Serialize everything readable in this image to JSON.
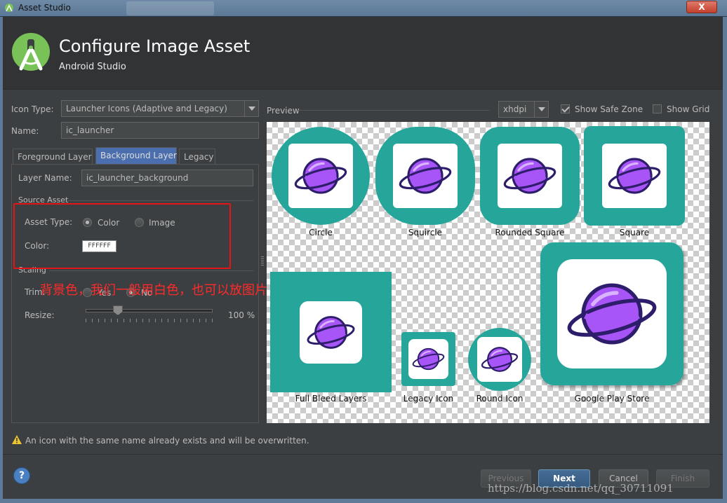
{
  "window": {
    "title": "Asset Studio",
    "close_label": "X"
  },
  "header": {
    "title": "Configure Image Asset",
    "subtitle": "Android Studio"
  },
  "form": {
    "icon_type_label": "Icon Type:",
    "icon_type_value": "Launcher Icons (Adaptive and Legacy)",
    "name_label": "Name:",
    "name_value": "ic_launcher"
  },
  "tabs": [
    {
      "label": "Foreground Layer",
      "active": false
    },
    {
      "label": "Background Layer",
      "active": true
    },
    {
      "label": "Legacy",
      "active": false
    }
  ],
  "layer": {
    "layer_name_label": "Layer Name:",
    "layer_name_value": "ic_launcher_background",
    "source_asset_label": "Source Asset",
    "asset_type_label": "Asset Type:",
    "asset_type_options": [
      "Color",
      "Image"
    ],
    "asset_type_selected": "Color",
    "color_label": "Color:",
    "color_value": "FFFFFF",
    "scaling_label": "Scaling",
    "trim_label": "Trim:",
    "trim_options": [
      "Yes",
      "No"
    ],
    "resize_label": "Resize:",
    "resize_value": "100 %"
  },
  "annotation": "背景色，我们一般用白色，也可以放图片",
  "preview": {
    "label": "Preview",
    "density": "xhdpi",
    "show_safe_zone_label": "Show Safe Zone",
    "show_safe_zone": true,
    "show_grid_label": "Show Grid",
    "show_grid": false,
    "icons": [
      "Circle",
      "Squircle",
      "Rounded Square",
      "Square",
      "Full Bleed Layers",
      "Legacy Icon",
      "Round Icon",
      "Google Play Store"
    ]
  },
  "colors": {
    "accent": "#26a69a",
    "planet": "#a855f7",
    "warning": "#f0c330"
  },
  "warning": "An icon with the same name already exists and will be overwritten.",
  "footer": {
    "help_label": "?",
    "previous_label": "Previous",
    "next_label": "Next",
    "cancel_label": "Cancel",
    "finish_label": "Finish"
  },
  "watermark": "https://blog.csdn.net/qq_30711091"
}
